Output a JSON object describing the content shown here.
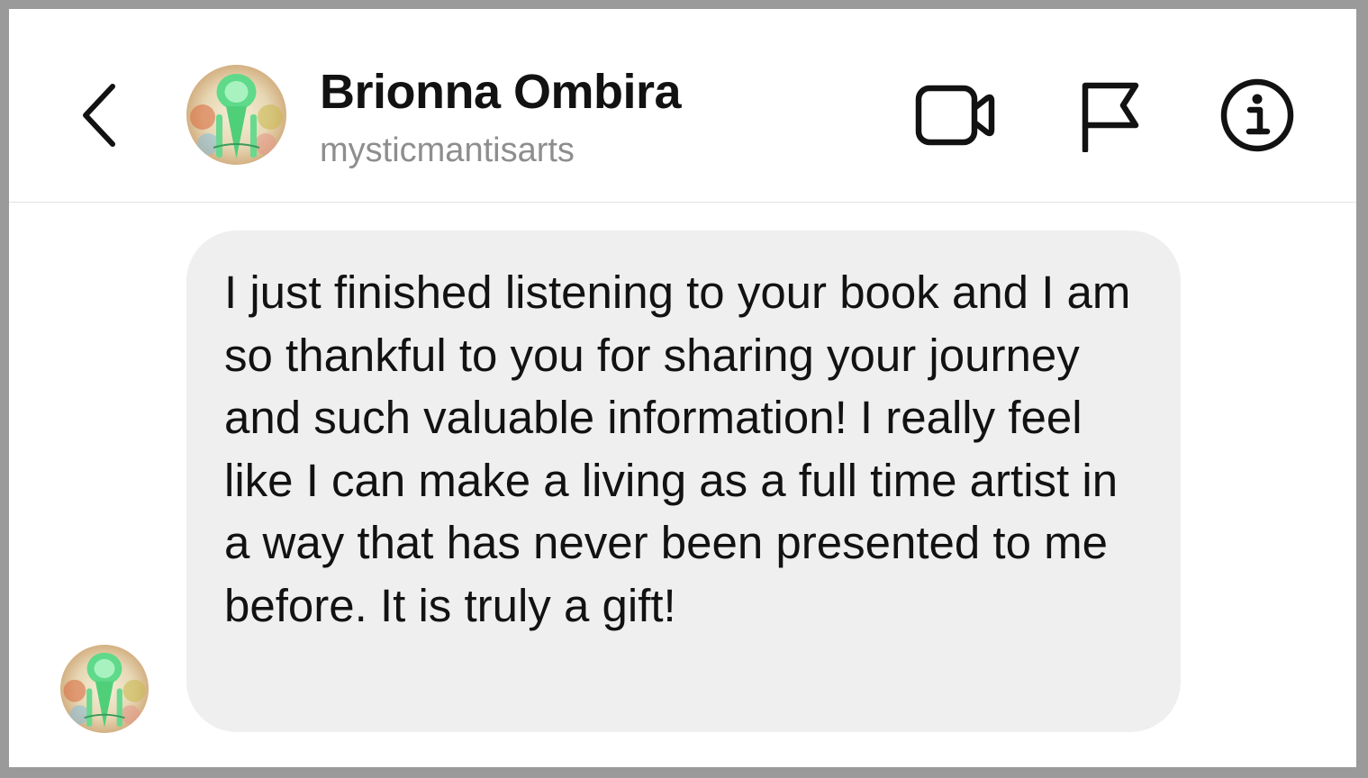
{
  "header": {
    "back_icon": "chevron-left-icon",
    "avatar_icon": "profile-avatar",
    "name": "Brionna Ombira",
    "username": "mysticmantisarts",
    "actions": [
      {
        "icon": "video-camera-icon"
      },
      {
        "icon": "flag-icon"
      },
      {
        "icon": "info-icon"
      }
    ]
  },
  "message": {
    "sender_avatar": "profile-avatar",
    "text": "I just finished listening to your book and I am so thankful to you for sharing your journey and such valuable information! I really feel like I can make a living as a full time artist in a way that has never been presented to me before. It is truly a gift!"
  },
  "colors": {
    "page_border": "#9a9a9a",
    "background": "#ffffff",
    "bubble": "#efefef",
    "text": "#121212",
    "secondary_text": "#8e8e8e",
    "divider": "#e3e3e3"
  }
}
